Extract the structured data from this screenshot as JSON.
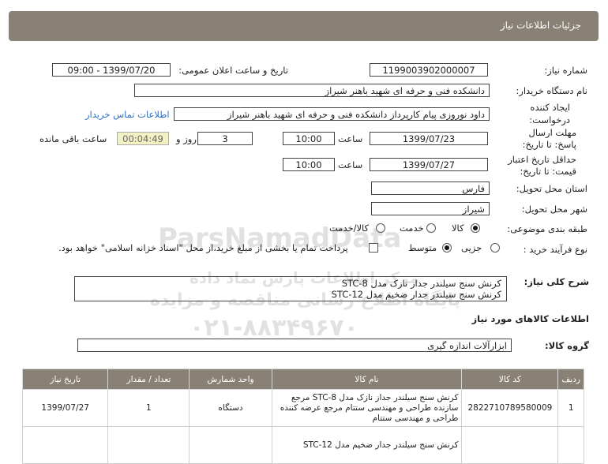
{
  "header": {
    "title": "جزئیات اطلاعات نیاز"
  },
  "fields": {
    "need_number_label": "شماره نیاز:",
    "need_number": "1199003902000007",
    "announce_label": "تاریخ و ساعت اعلان عمومی:",
    "announce_value": "1399/07/20 - 09:00",
    "buyer_label": "نام دستگاه خریدار:",
    "buyer_value": "دانشکده فنی و حرفه ای شهید باهنر شیراز",
    "creator_label": "ایجاد کننده درخواست:",
    "creator_value": "داود نوروزی پیام کارپرداز دانشکده فنی و حرفه ای شهید باهنر شیراز",
    "contact_link": "اطلاعات تماس خریدار",
    "deadline_label": "مهلت ارسال پاسخ: تا تاریخ:",
    "deadline_date": "1399/07/23",
    "time_label": "ساعت",
    "deadline_time": "10:00",
    "days_value": "3",
    "days_label": "روز و",
    "remaining_time": "00:04:49",
    "remaining_label": "ساعت باقی مانده",
    "validity_label": "حداقل تاریخ اعتبار قیمت: تا تاریخ:",
    "validity_date": "1399/07/27",
    "validity_time": "10:00",
    "province_label": "استان محل تحویل:",
    "province_value": "فارس",
    "city_label": "شهر محل تحویل:",
    "city_value": "شیراز",
    "category_label": "طبقه بندی موضوعی:",
    "category_options": [
      "کالا",
      "خدمت",
      "کالا/خدمت"
    ],
    "category_selected": "کالا",
    "process_label": "نوع فرآیند خرید :",
    "process_options": [
      "جزیی",
      "متوسط"
    ],
    "process_selected": "متوسط",
    "payment_note": "پرداخت تمام یا بخشی از مبلغ خرید،از محل \"اسناد خزانه اسلامی\" خواهد بود."
  },
  "description": {
    "label": "شرح کلی نیاز:",
    "lines": [
      "کرنش سنج سیلندر جدار نازک مدل STC-8",
      "کرنش سنج سیلندر جدار ضخیم مدل STC-12"
    ]
  },
  "goods": {
    "section_title": "اطلاعات کالاهای مورد نیاز",
    "group_label": "گروه کالا:",
    "group_value": "ابزارآلات اندازه گیری"
  },
  "table": {
    "headers": [
      "ردیف",
      "کد کالا",
      "نام کالا",
      "واحد شمارش",
      "تعداد / مقدار",
      "تاریخ نیاز"
    ],
    "rows": [
      {
        "row": "1",
        "code": "2822710789580009",
        "name": "کرنش سنج سیلندر جداز نازک مدل STC-8 مرجع سازنده طراحی و مهندسی ستتام مرجع عرضه کننده طراحی و مهندسی ستتام",
        "unit": "دستگاه",
        "qty": "1",
        "date": "1399/07/27"
      },
      {
        "row": "",
        "code": "",
        "name": "کرنش سنج سیلندر جدار ضخیم مدل STC-12",
        "unit": "",
        "qty": "",
        "date": ""
      }
    ]
  },
  "watermark": {
    "line1": "ParsNamadData",
    "line2": "مرکز اطلاعات پارس نماد داده",
    "line3": "پایگاه اطلاع رسانی مناقصه و مزایده",
    "line4": "۰۲۱-۸۸۳۴۹۶۷۰"
  }
}
